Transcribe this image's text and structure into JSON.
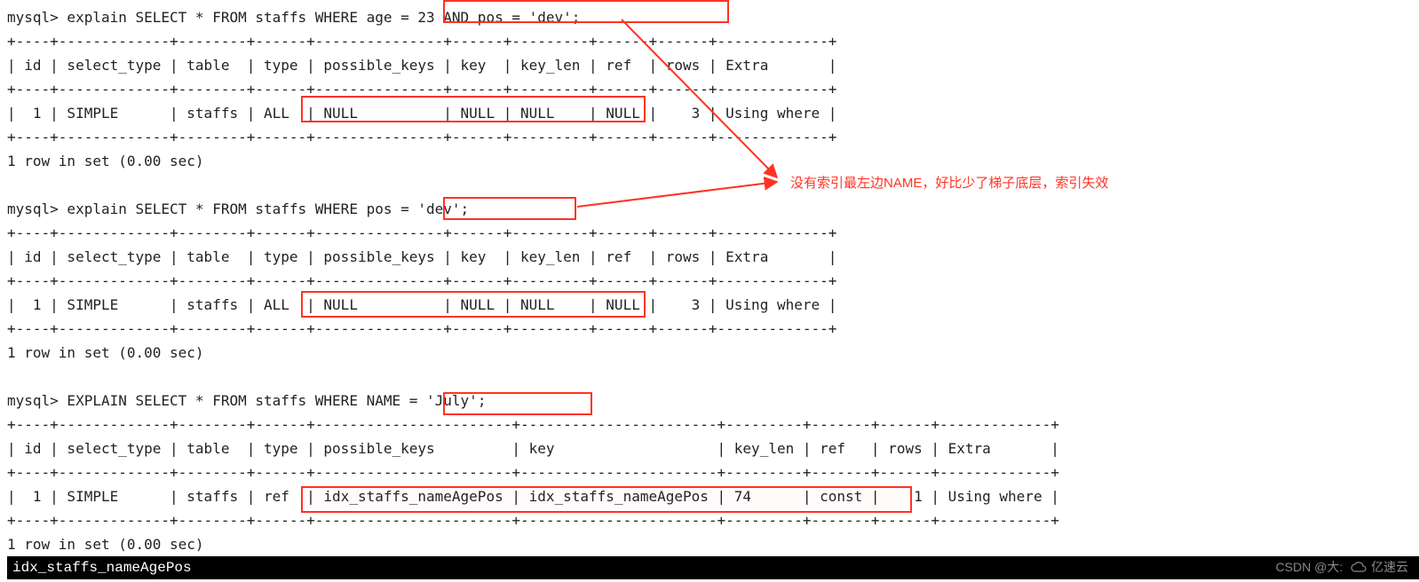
{
  "query1": {
    "prompt": "mysql> explain SELECT * FROM staffs WHERE ",
    "cond": "age = 23 AND pos = 'dev'",
    "tail": ";",
    "border_top": "+----+-------------+--------+------+---------------+------+---------+------+------+-------------+",
    "header": "| id | select_type | table  | type | possible_keys | key  | key_len | ref  | rows | Extra       |",
    "border_mid": "+----+-------------+--------+------+---------------+------+---------+------+------+-------------+",
    "row": "|  1 | SIMPLE      | staffs | ALL  | NULL          | NULL | NULL    | NULL |    3 | Using where |",
    "border_bot": "+----+-------------+--------+------+---------------+------+---------+------+------+-------------+",
    "footer": "1 row in set (0.00 sec)"
  },
  "query2": {
    "prompt": "mysql> explain SELECT * FROM staffs WHERE ",
    "cond": "pos = 'dev'",
    "tail": ";",
    "border_top": "+----+-------------+--------+------+---------------+------+---------+------+------+-------------+",
    "header": "| id | select_type | table  | type | possible_keys | key  | key_len | ref  | rows | Extra       |",
    "border_mid": "+----+-------------+--------+------+---------------+------+---------+------+------+-------------+",
    "row": "|  1 | SIMPLE      | staffs | ALL  | NULL          | NULL | NULL    | NULL |    3 | Using where |",
    "border_bot": "+----+-------------+--------+------+---------------+------+---------+------+------+-------------+",
    "footer": "1 row in set (0.00 sec)"
  },
  "query3": {
    "prompt": "mysql> EXPLAIN SELECT * FROM staffs WHERE ",
    "cond": "NAME = 'July'",
    "tail": ";",
    "border_top": "+----+-------------+--------+------+-----------------------+-----------------------+---------+-------+------+-------------+",
    "header": "| id | select_type | table  | type | possible_keys         | key                   | key_len | ref   | rows | Extra       |",
    "border_mid": "+----+-------------+--------+------+-----------------------+-----------------------+---------+-------+------+-------------+",
    "row": "|  1 | SIMPLE      | staffs | ref  | idx_staffs_nameAgePos | idx_staffs_nameAgePos | 74      | const |    1 | Using where |",
    "border_bot": "+----+-------------+--------+------+-----------------------+-----------------------+---------+-------+------+-------------+",
    "footer": "1 row in set (0.00 sec)"
  },
  "annotation": "没有索引最左边NAME，好比少了梯子底层，索引失效",
  "blackbox_text": "idx_staffs_nameAgePos",
  "footer_csdn": "CSDN @大:",
  "footer_brand": "亿速云"
}
